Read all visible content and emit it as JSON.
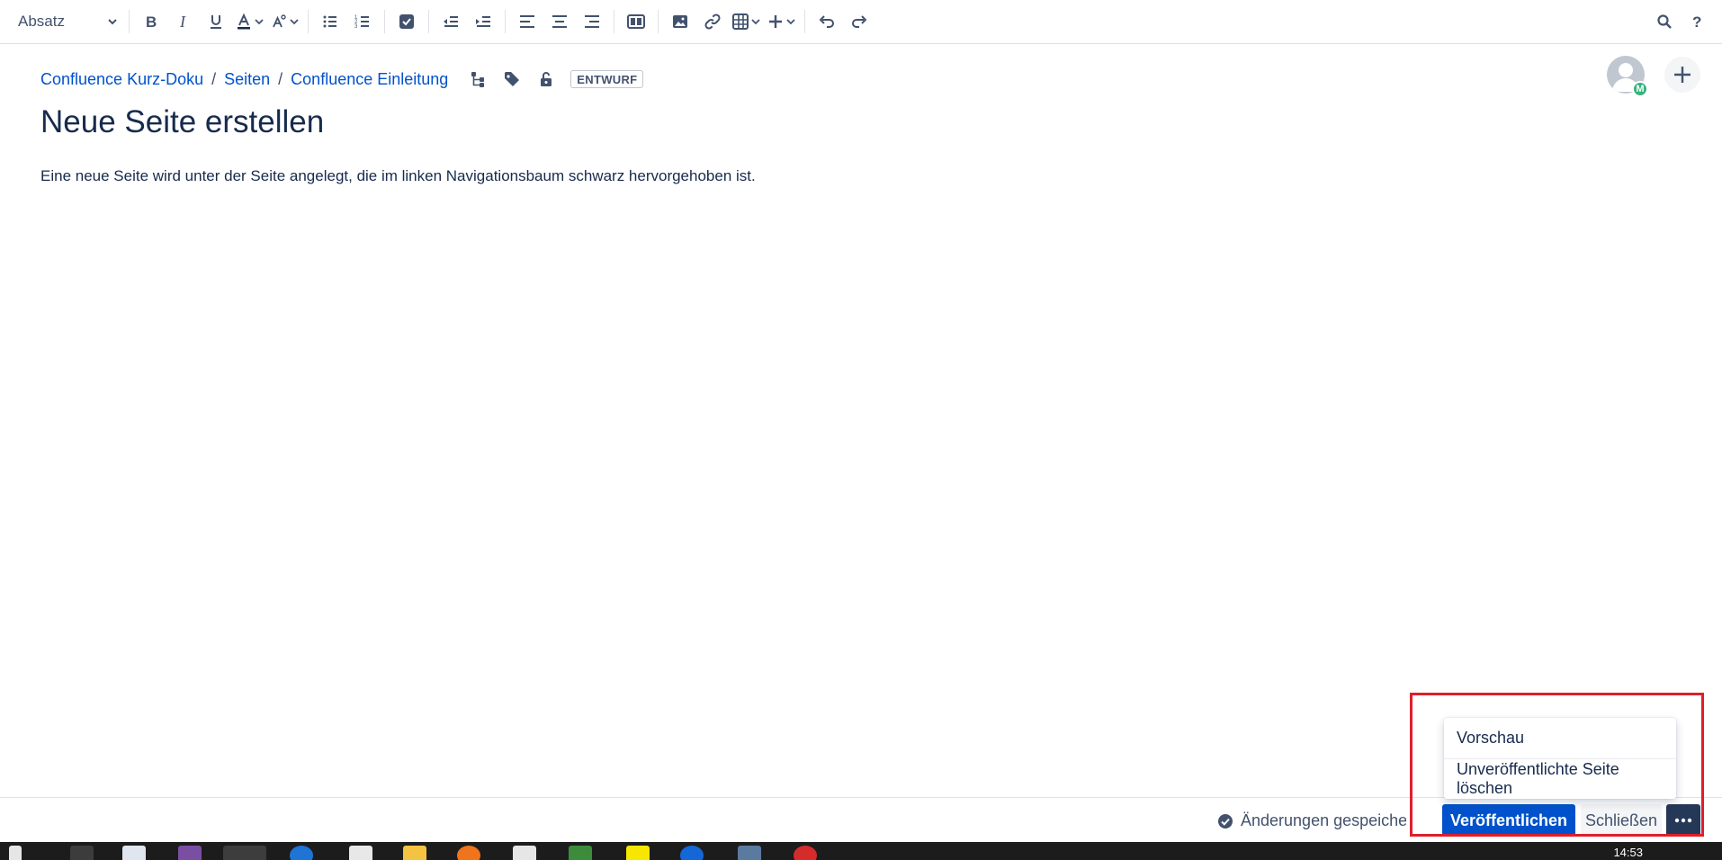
{
  "toolbar": {
    "paragraph_style": "Absatz",
    "buttons": [
      "bold-icon",
      "italic-icon",
      "underline-icon",
      "text-color-icon",
      "text-style-icon",
      "bullet-list-icon",
      "numbered-list-icon",
      "task-icon",
      "outdent-icon",
      "indent-icon",
      "align-left-icon",
      "align-center-icon",
      "align-right-icon",
      "layout-icon",
      "image-icon",
      "link-icon",
      "table-icon",
      "insert-icon",
      "undo-icon",
      "redo-icon",
      "search-icon",
      "help-icon"
    ]
  },
  "breadcrumb": {
    "items": [
      "Confluence Kurz-Doku",
      "Seiten",
      "Confluence Einleitung"
    ],
    "separator": "/",
    "status": "ENTWURF"
  },
  "avatar": {
    "badge": "M"
  },
  "page": {
    "title": "Neue Seite erstellen",
    "body": "Eine neue Seite wird unter der Seite angelegt, die im linken Navigationsbaum schwarz hervorgehoben ist."
  },
  "footer": {
    "saved_status": "Änderungen gespeichert",
    "publish_label": "Veröffentlichen",
    "close_label": "Schließen",
    "more_label": "···"
  },
  "more_menu": {
    "items": [
      "Vorschau",
      "Unveröffentlichte Seite löschen"
    ]
  },
  "taskbar": {
    "time": "14:53"
  },
  "colors": {
    "link": "#0052cc",
    "primary": "#0052cc",
    "text": "#172b4d",
    "annotation": "#e01e2b"
  }
}
